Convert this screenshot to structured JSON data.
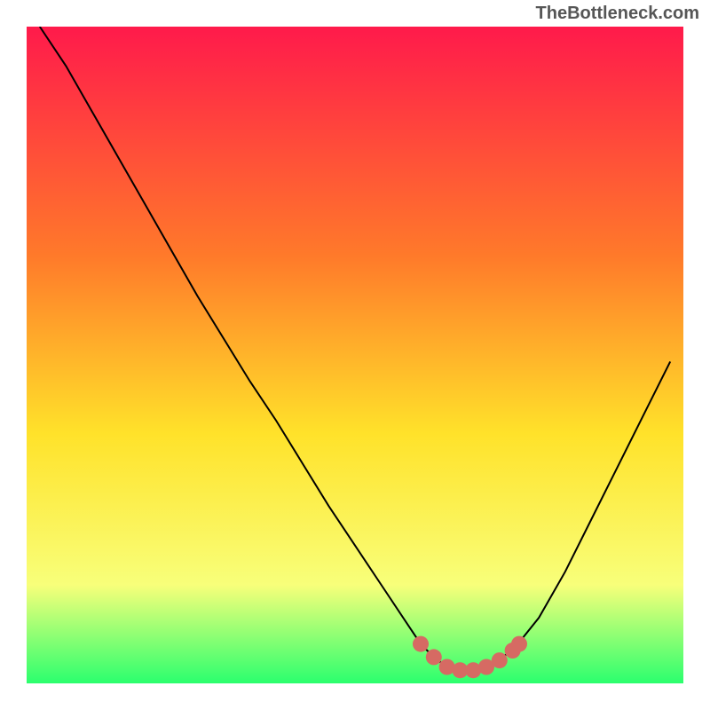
{
  "attribution": "TheBottleneck.com",
  "colors": {
    "gradient_top": "#ff1a4b",
    "gradient_mid1": "#ff7a2a",
    "gradient_mid2": "#ffe22a",
    "gradient_mid3": "#f8ff7a",
    "gradient_bottom": "#2bff6e",
    "curve": "#000000",
    "marker": "#d66a63"
  },
  "chart_data": {
    "type": "line",
    "title": "",
    "xlabel": "",
    "ylabel": "",
    "xlim": [
      0,
      100
    ],
    "ylim": [
      0,
      100
    ],
    "series": [
      {
        "name": "bottleneck-curve",
        "x": [
          2,
          6,
          10,
          14,
          18,
          22,
          26,
          30,
          34,
          38,
          42,
          46,
          50,
          54,
          58,
          60,
          62,
          64,
          66,
          68,
          70,
          74,
          78,
          82,
          86,
          90,
          94,
          98
        ],
        "y": [
          100,
          94,
          87,
          80,
          73,
          66,
          59,
          52.5,
          46,
          40,
          33.5,
          27,
          21,
          15,
          9,
          6,
          4,
          2.5,
          2,
          2,
          2.5,
          5,
          10,
          17,
          25,
          33,
          41,
          49
        ]
      }
    ],
    "markers": {
      "name": "highlight-zone",
      "x": [
        60,
        62,
        64,
        66,
        68,
        70,
        72,
        74,
        75
      ],
      "y": [
        6.0,
        4.0,
        2.5,
        2.0,
        2.0,
        2.5,
        3.5,
        5.0,
        6.0
      ]
    }
  }
}
